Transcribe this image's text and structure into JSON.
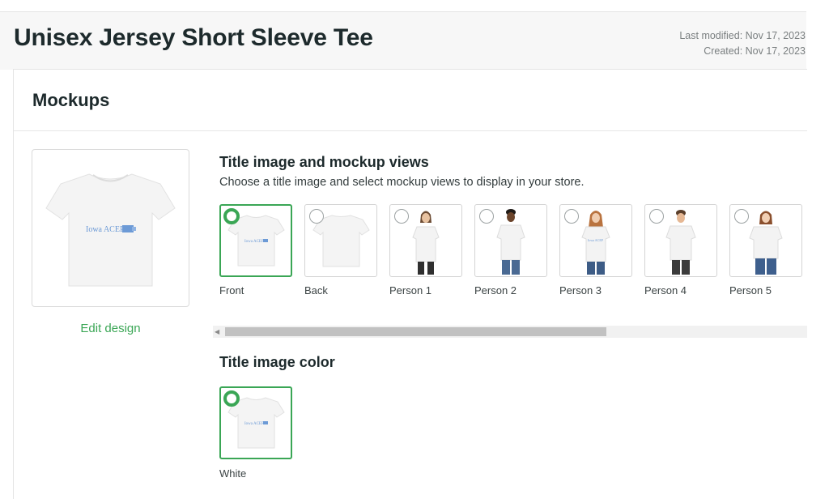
{
  "header": {
    "title": "Unisex Jersey Short Sleeve Tee",
    "last_modified": "Last modified: Nov 17, 2023",
    "created": "Created: Nov 17, 2023"
  },
  "mockups": {
    "title": "Mockups",
    "edit_design": "Edit design",
    "preview_design_text": "Iowa ACEP",
    "views": {
      "title": "Title image and mockup views",
      "subtitle": "Choose a title image and select mockup views to display in your store.",
      "items": [
        {
          "label": "Front",
          "selected": true
        },
        {
          "label": "Back",
          "selected": false
        },
        {
          "label": "Person 1",
          "selected": false
        },
        {
          "label": "Person 2",
          "selected": false
        },
        {
          "label": "Person 3",
          "selected": false
        },
        {
          "label": "Person 4",
          "selected": false
        },
        {
          "label": "Person 5",
          "selected": false
        }
      ]
    },
    "color": {
      "title": "Title image color",
      "items": [
        {
          "label": "White",
          "selected": true
        }
      ]
    }
  },
  "colors": {
    "accent": "#3aa655",
    "design_blue": "#6c9ad6"
  }
}
